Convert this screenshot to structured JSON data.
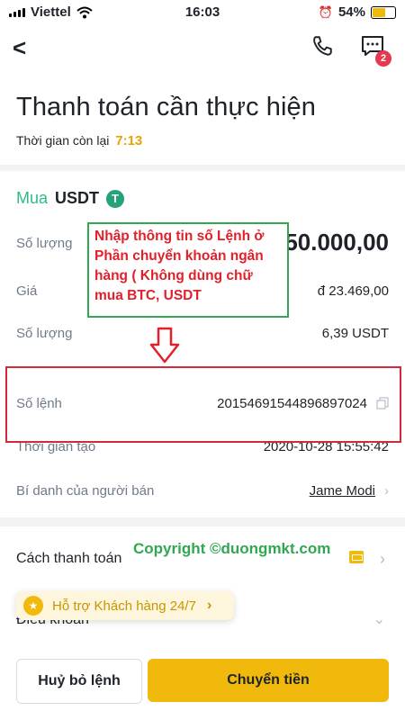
{
  "status": {
    "carrier": "Viettel",
    "time": "16:03",
    "battery": "54%",
    "battery_level": 0.54
  },
  "header": {
    "title": "Thanh toán cần thực hiện",
    "countdown_label": "Thời gian còn lại",
    "countdown_value": "7:13",
    "chat_badge": "2"
  },
  "order": {
    "side": "Mua",
    "asset": "USDT",
    "asset_icon": "T",
    "rows": [
      {
        "label": "Số lượng",
        "value": "đ 150.000,00"
      },
      {
        "label": "Giá",
        "value": "đ 23.469,00"
      },
      {
        "label": "Số lượng",
        "value": "6,39 USDT"
      },
      {
        "label": "Số lệnh",
        "value": "20154691544896897024"
      },
      {
        "label": "Thời gian tạo",
        "value": "2020-10-28 15:55:42"
      },
      {
        "label": "Bí danh của người bán",
        "value": "Jame Modi"
      }
    ]
  },
  "annotation": {
    "text": "Nhập thông tin số Lệnh ở Phần chuyển khoản ngân hàng ( Không dùng chữ mua BTC, USDT",
    "watermark": "Copyright ©duongmkt.com"
  },
  "payment": {
    "label": "Cách thanh toán"
  },
  "terms": {
    "label": "Điều khoản"
  },
  "support": {
    "label": "Hỗ trợ Khách hàng 24/7"
  },
  "actions": {
    "cancel_label": "Huỷ bỏ lệnh",
    "pay_label": "Chuyển tiền"
  },
  "colors": {
    "accent": "#f0b90b",
    "buy_green": "#2ebd85",
    "annotation_red": "#e2202a",
    "annotation_green": "#2fa84f"
  }
}
